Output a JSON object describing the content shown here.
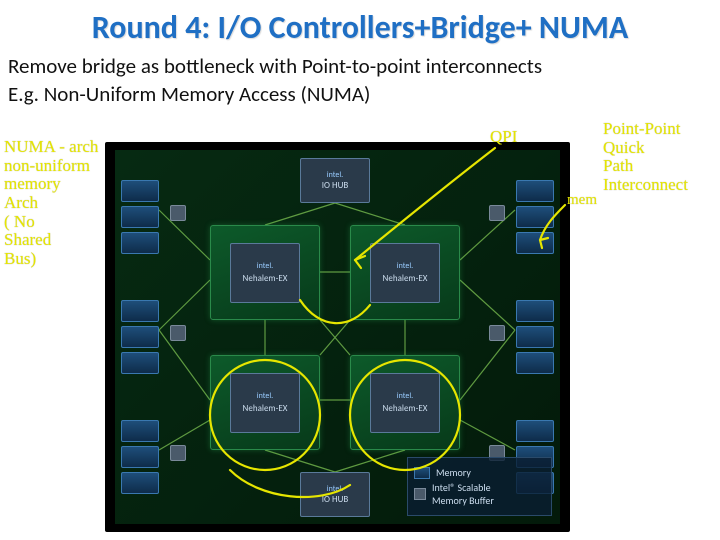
{
  "title": "Round 4: I/O Controllers+Bridge+ NUMA",
  "subtitle_line1": "Remove bridge as bottleneck with Point-to-point interconnects",
  "subtitle_line2": "E.g. Non-Uniform Memory Access (NUMA)",
  "cpu": {
    "brand": "intel.",
    "label": "Nehalem-EX"
  },
  "iohub": {
    "brand": "intel.",
    "label": "IO HUB"
  },
  "legend": {
    "memory": "Memory",
    "buffer": "Intel® Scalable\nMemory Buffer"
  },
  "annotations": {
    "left_block": "NUMA - arch\nnon-uniform\nmemory\nArch\n( No\nShared\nBus)",
    "qpi": "QPI",
    "mem": "mem",
    "right_block": "Point-Point\nQuick\nPath\nInterconnect"
  }
}
